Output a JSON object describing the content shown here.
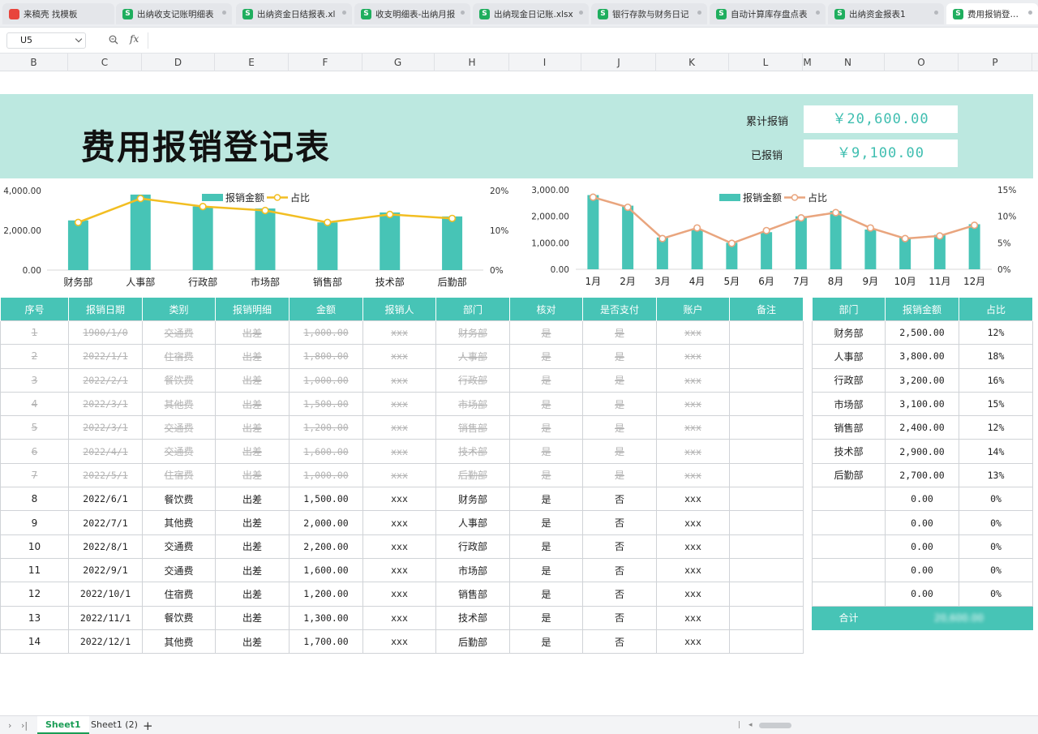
{
  "tabs": [
    {
      "label": "来稿壳 找模板",
      "icon": "red-app-icon",
      "active": false
    },
    {
      "label": "出纳收支记账明细表",
      "icon": "sheet-icon",
      "active": false
    },
    {
      "label": "出纳资金日结报表.xl",
      "icon": "sheet-icon",
      "active": false
    },
    {
      "label": "收支明细表-出纳月报",
      "icon": "sheet-icon",
      "active": false
    },
    {
      "label": "出纳现金日记账.xlsx",
      "icon": "sheet-icon",
      "active": false
    },
    {
      "label": "银行存款与财务日记",
      "icon": "sheet-icon",
      "active": false
    },
    {
      "label": "自动计算库存盘点表",
      "icon": "sheet-icon",
      "active": false
    },
    {
      "label": "出纳资金报表1",
      "icon": "sheet-icon",
      "active": false
    },
    {
      "label": "费用报销登记表",
      "icon": "sheet-icon",
      "active": true
    }
  ],
  "formula": {
    "cell_ref": "U5",
    "fx_label": "fx",
    "content": ""
  },
  "columns": [
    "B",
    "C",
    "D",
    "E",
    "F",
    "G",
    "H",
    "I",
    "J",
    "K",
    "L",
    "M",
    "N",
    "O",
    "P"
  ],
  "banner": {
    "title": "费用报销登记表",
    "cumulative_label": "累计报销",
    "cumulative_value": "￥20,600.00",
    "reimbursed_label": "已报销",
    "reimbursed_value": "￥9,100.00"
  },
  "chart_data": [
    {
      "type": "bar",
      "legend": [
        "报销金额",
        "占比"
      ],
      "legend_position": "top-center",
      "categories": [
        "财务部",
        "人事部",
        "行政部",
        "市场部",
        "销售部",
        "技术部",
        "后勤部"
      ],
      "series": [
        {
          "name": "报销金额",
          "values": [
            2500,
            3800,
            3200,
            3100,
            2400,
            2900,
            2700
          ],
          "axis": "left",
          "type": "bar"
        },
        {
          "name": "占比",
          "values": [
            12,
            18,
            16,
            15,
            12,
            14,
            13
          ],
          "axis": "right",
          "type": "line"
        }
      ],
      "y_left_ticks": [
        "0.00",
        "2,000.00",
        "4,000.00"
      ],
      "y_left_range": [
        0,
        4000
      ],
      "y_right_ticks": [
        "0%",
        "10%",
        "20%"
      ],
      "y_right_range": [
        0,
        20
      ],
      "colors": {
        "bar": "#47c4b6",
        "line": "#f2be22"
      }
    },
    {
      "type": "bar",
      "legend": [
        "报销金额",
        "占比"
      ],
      "legend_position": "top-center",
      "categories": [
        "1月",
        "2月",
        "3月",
        "4月",
        "5月",
        "6月",
        "7月",
        "8月",
        "9月",
        "10月",
        "11月",
        "12月"
      ],
      "series": [
        {
          "name": "报销金额",
          "values": [
            2800,
            2400,
            1200,
            1500,
            1000,
            1400,
            2000,
            2200,
            1500,
            1200,
            1300,
            1700
          ],
          "axis": "left",
          "type": "bar"
        },
        {
          "name": "占比",
          "values": [
            13.6,
            11.7,
            5.8,
            7.8,
            4.9,
            7.3,
            9.7,
            10.7,
            7.8,
            5.8,
            6.3,
            8.3
          ],
          "axis": "right",
          "type": "line"
        }
      ],
      "y_left_ticks": [
        "0.00",
        "1,000.00",
        "2,000.00",
        "3,000.00"
      ],
      "y_left_range": [
        0,
        3000
      ],
      "y_right_ticks": [
        "0%",
        "5%",
        "10%",
        "15%"
      ],
      "y_right_range": [
        0,
        15
      ],
      "colors": {
        "bar": "#47c4b6",
        "line": "#e9a57e"
      }
    }
  ],
  "main_table": {
    "headers": [
      "序号",
      "报销日期",
      "类别",
      "报销明细",
      "金额",
      "报销人",
      "部门",
      "核对",
      "是否支付",
      "账户",
      "备注"
    ],
    "rows": [
      {
        "struck": true,
        "cells": [
          "1",
          "1900/1/0",
          "交通费",
          "出差",
          "1,000.00",
          "xxx",
          "财务部",
          "是",
          "是",
          "xxx",
          ""
        ]
      },
      {
        "struck": true,
        "cells": [
          "2",
          "2022/1/1",
          "住宿费",
          "出差",
          "1,800.00",
          "xxx",
          "人事部",
          "是",
          "是",
          "xxx",
          ""
        ]
      },
      {
        "struck": true,
        "cells": [
          "3",
          "2022/2/1",
          "餐饮费",
          "出差",
          "1,000.00",
          "xxx",
          "行政部",
          "是",
          "是",
          "xxx",
          ""
        ]
      },
      {
        "struck": true,
        "cells": [
          "4",
          "2022/3/1",
          "其他费",
          "出差",
          "1,500.00",
          "xxx",
          "市场部",
          "是",
          "是",
          "xxx",
          ""
        ]
      },
      {
        "struck": true,
        "cells": [
          "5",
          "2022/3/1",
          "交通费",
          "出差",
          "1,200.00",
          "xxx",
          "销售部",
          "是",
          "是",
          "xxx",
          ""
        ]
      },
      {
        "struck": true,
        "cells": [
          "6",
          "2022/4/1",
          "交通费",
          "出差",
          "1,600.00",
          "xxx",
          "技术部",
          "是",
          "是",
          "xxx",
          ""
        ]
      },
      {
        "struck": true,
        "cells": [
          "7",
          "2022/5/1",
          "住宿费",
          "出差",
          "1,000.00",
          "xxx",
          "后勤部",
          "是",
          "是",
          "xxx",
          ""
        ]
      },
      {
        "struck": false,
        "cells": [
          "8",
          "2022/6/1",
          "餐饮费",
          "出差",
          "1,500.00",
          "xxx",
          "财务部",
          "是",
          "否",
          "xxx",
          ""
        ]
      },
      {
        "struck": false,
        "cells": [
          "9",
          "2022/7/1",
          "其他费",
          "出差",
          "2,000.00",
          "xxx",
          "人事部",
          "是",
          "否",
          "xxx",
          ""
        ]
      },
      {
        "struck": false,
        "cells": [
          "10",
          "2022/8/1",
          "交通费",
          "出差",
          "2,200.00",
          "xxx",
          "行政部",
          "是",
          "否",
          "xxx",
          ""
        ]
      },
      {
        "struck": false,
        "cells": [
          "11",
          "2022/9/1",
          "交通费",
          "出差",
          "1,600.00",
          "xxx",
          "市场部",
          "是",
          "否",
          "xxx",
          ""
        ]
      },
      {
        "struck": false,
        "cells": [
          "12",
          "2022/10/1",
          "住宿费",
          "出差",
          "1,200.00",
          "xxx",
          "销售部",
          "是",
          "否",
          "xxx",
          ""
        ]
      },
      {
        "struck": false,
        "cells": [
          "13",
          "2022/11/1",
          "餐饮费",
          "出差",
          "1,300.00",
          "xxx",
          "技术部",
          "是",
          "否",
          "xxx",
          ""
        ]
      },
      {
        "struck": false,
        "cells": [
          "14",
          "2022/12/1",
          "其他费",
          "出差",
          "1,700.00",
          "xxx",
          "后勤部",
          "是",
          "否",
          "xxx",
          ""
        ]
      }
    ]
  },
  "side_table": {
    "headers": [
      "部门",
      "报销金额",
      "占比"
    ],
    "rows": [
      [
        "财务部",
        "2,500.00",
        "12%"
      ],
      [
        "人事部",
        "3,800.00",
        "18%"
      ],
      [
        "行政部",
        "3,200.00",
        "16%"
      ],
      [
        "市场部",
        "3,100.00",
        "15%"
      ],
      [
        "销售部",
        "2,400.00",
        "12%"
      ],
      [
        "技术部",
        "2,900.00",
        "14%"
      ],
      [
        "后勤部",
        "2,700.00",
        "13%"
      ],
      [
        "",
        "0.00",
        "0%"
      ],
      [
        "",
        "0.00",
        "0%"
      ],
      [
        "",
        "0.00",
        "0%"
      ],
      [
        "",
        "0.00",
        "0%"
      ],
      [
        "",
        "0.00",
        "0%"
      ]
    ],
    "total_label": "合计",
    "total_value": "20,600.00"
  },
  "sheets": {
    "tabs": [
      "Sheet1",
      "Sheet1 (2)"
    ],
    "active_index": 0,
    "add_label": "+"
  }
}
